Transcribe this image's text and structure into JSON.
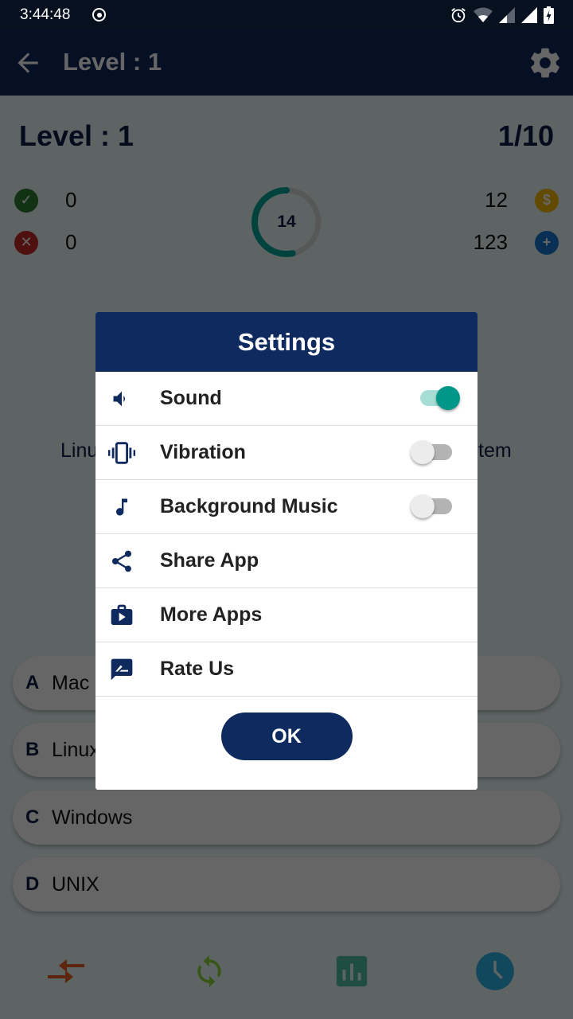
{
  "status_bar": {
    "time": "3:44:48",
    "icons": [
      "record-icon",
      "alarm-icon",
      "wifi-icon",
      "signal-icon",
      "signal-icon",
      "battery-charging-icon"
    ]
  },
  "app_bar": {
    "title": "Level : 1",
    "back_icon": "arrow-left-icon",
    "settings_icon": "gear-icon"
  },
  "quiz": {
    "level_label": "Level : 1",
    "question_progress": "1/10",
    "correct_count": "0",
    "wrong_count": "0",
    "coins": "12",
    "hints": "123",
    "timer_value": "14",
    "timer_fraction_remaining": 0.53,
    "question_fragment_left": "Linu",
    "question_fragment_right": "tem",
    "options": [
      {
        "letter": "A",
        "text": "Mac"
      },
      {
        "letter": "B",
        "text": "Linux"
      },
      {
        "letter": "C",
        "text": "Windows"
      },
      {
        "letter": "D",
        "text": "UNIX"
      }
    ]
  },
  "bottom_bar": {
    "buttons": [
      {
        "name": "fifty-fifty",
        "icon": "arrows-converge-icon",
        "color": "#c0440f"
      },
      {
        "name": "skip",
        "icon": "refresh-icon",
        "color": "#5a9c22"
      },
      {
        "name": "audience-poll",
        "icon": "bar-chart-icon",
        "color": "#2e8c76"
      },
      {
        "name": "reset-timer",
        "icon": "clock-icon",
        "color": "#1b87ad"
      }
    ]
  },
  "settings_dialog": {
    "title": "Settings",
    "items": [
      {
        "label": "Sound",
        "icon": "volume-icon",
        "toggle": true,
        "on": true
      },
      {
        "label": "Vibration",
        "icon": "vibration-icon",
        "toggle": true,
        "on": false
      },
      {
        "label": "Background Music",
        "icon": "music-note-icon",
        "toggle": true,
        "on": false
      },
      {
        "label": "Share App",
        "icon": "share-icon",
        "toggle": false
      },
      {
        "label": "More Apps",
        "icon": "store-icon",
        "toggle": false
      },
      {
        "label": "Rate Us",
        "icon": "rate-review-icon",
        "toggle": false
      }
    ],
    "ok_label": "OK"
  },
  "colors": {
    "primary": "#0f2a5e",
    "accent": "#009688",
    "correct": "#2e7d32",
    "wrong": "#c62828",
    "coin": "#f5b800",
    "hint": "#1976d2"
  }
}
